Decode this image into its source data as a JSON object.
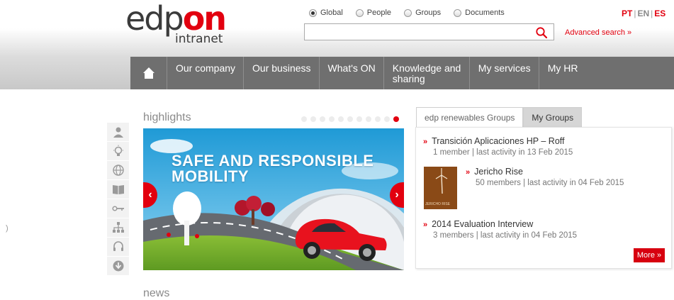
{
  "logo": {
    "main": "edp",
    "accent": "on",
    "sub": "intranet"
  },
  "search": {
    "scopes": [
      {
        "label": "Global",
        "selected": true
      },
      {
        "label": "People",
        "selected": false
      },
      {
        "label": "Groups",
        "selected": false
      },
      {
        "label": "Documents",
        "selected": false
      }
    ],
    "placeholder": "",
    "advanced": "Advanced search »"
  },
  "languages": {
    "pt": "PT",
    "sep": "|",
    "en": "EN",
    "es": "ES"
  },
  "nav": {
    "home_icon": "home-icon",
    "items": [
      "Our company",
      "Our business",
      "What's ON",
      "Knowledge and sharing",
      "My services",
      "My HR"
    ]
  },
  "side_icons": [
    "person-icon",
    "lightbulb-icon",
    "globe-icon",
    "book-icon",
    "key-icon",
    "org-chart-icon",
    "headset-icon",
    "download-icon"
  ],
  "left_mark": ")",
  "highlights": {
    "title": "highlights",
    "active_dot": 10,
    "dot_count": 11,
    "banner_title_line1": "SAFE AND RESPONSIBLE",
    "banner_title_line2": "MOBILITY",
    "prev_icon": "chevron-left-icon",
    "next_icon": "chevron-right-icon"
  },
  "groups": {
    "tabs": [
      "edp renewables Groups",
      "My Groups"
    ],
    "items": [
      {
        "title": "Transición Aplicaciones HP – Roff",
        "meta": "1 member | last activity in 13 Feb 2015"
      },
      {
        "title": "Jericho Rise",
        "meta": "50 members | last activity in 04 Feb 2015",
        "thumb_text": "JERICHO RISE"
      },
      {
        "title": "2014 Evaluation Interview",
        "meta": "3 members | last activity in 04 Feb 2015"
      }
    ],
    "more": "More »"
  },
  "news": {
    "title": "news"
  },
  "colors": {
    "brand_red": "#e2000f",
    "nav_gray": "#6f6f6f"
  }
}
